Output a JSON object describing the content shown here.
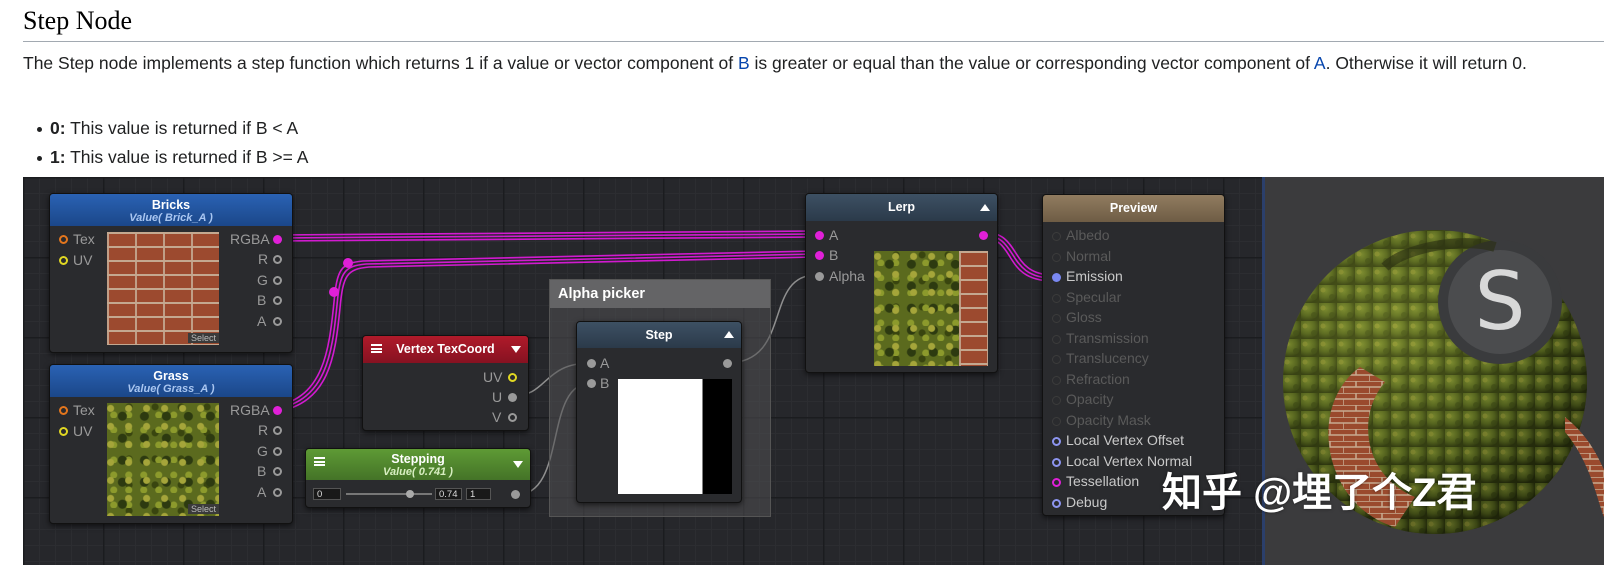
{
  "doc": {
    "title": "Step Node",
    "description": {
      "part1": "The Step node implements a step function which returns 1 if a value or vector component of ",
      "link_b": "B",
      "part2": " is greater or equal than the value or corresponding vector component of ",
      "link_a": "A",
      "part3": ". Otherwise it will return 0."
    },
    "bullets": [
      {
        "key": "0:",
        "text": " This value is returned if B < A"
      },
      {
        "key": "1:",
        "text": " This value is returned if B >= A"
      }
    ]
  },
  "nodes": {
    "bricks": {
      "title": "Bricks",
      "subtitle": "Value( Brick_A )",
      "inputs": [
        "Tex",
        "UV"
      ],
      "outputs": [
        "RGBA",
        "R",
        "G",
        "B",
        "A"
      ],
      "select": "Select"
    },
    "grass": {
      "title": "Grass",
      "subtitle": "Value( Grass_A )",
      "inputs": [
        "Tex",
        "UV"
      ],
      "outputs": [
        "RGBA",
        "R",
        "G",
        "B",
        "A"
      ],
      "select": "Select"
    },
    "vertex_texcoord": {
      "title": "Vertex TexCoord",
      "outputs": [
        "UV",
        "U",
        "V"
      ]
    },
    "stepping": {
      "title": "Stepping",
      "subtitle": "Value( 0.741 )",
      "min": "0",
      "value": "0.74",
      "max": "1",
      "slider_fraction": 0.741
    },
    "alpha_picker": {
      "title": "Alpha picker"
    },
    "step": {
      "title": "Step",
      "inputs": [
        "A",
        "B"
      ]
    },
    "lerp": {
      "title": "Lerp",
      "inputs": [
        "A",
        "B",
        "Alpha"
      ]
    },
    "preview": {
      "title": "Preview",
      "inputs": [
        {
          "label": "Albedo",
          "active": false
        },
        {
          "label": "Normal",
          "active": false
        },
        {
          "label": "Emission",
          "active": true
        },
        {
          "label": "Specular",
          "active": false
        },
        {
          "label": "Gloss",
          "active": false
        },
        {
          "label": "Transmission",
          "active": false
        },
        {
          "label": "Translucency",
          "active": false
        },
        {
          "label": "Refraction",
          "active": false
        },
        {
          "label": "Opacity",
          "active": false
        },
        {
          "label": "Opacity Mask",
          "active": false
        },
        {
          "label": "Local Vertex Offset",
          "active": true
        },
        {
          "label": "Local Vertex Normal",
          "active": true
        },
        {
          "label": "Tessellation",
          "active": true
        },
        {
          "label": "Debug",
          "active": true
        }
      ]
    }
  },
  "watermark": "知乎 @埋了个Z君",
  "colors": {
    "wire_magenta": "#d21ad0",
    "wire_gray": "#8f8f8f",
    "bricks_header": "#2a62b4",
    "vertex_header": "#b01a2a",
    "stepping_header": "#5e9a35",
    "preview_header": "#917c60",
    "link": "#0645ad"
  }
}
